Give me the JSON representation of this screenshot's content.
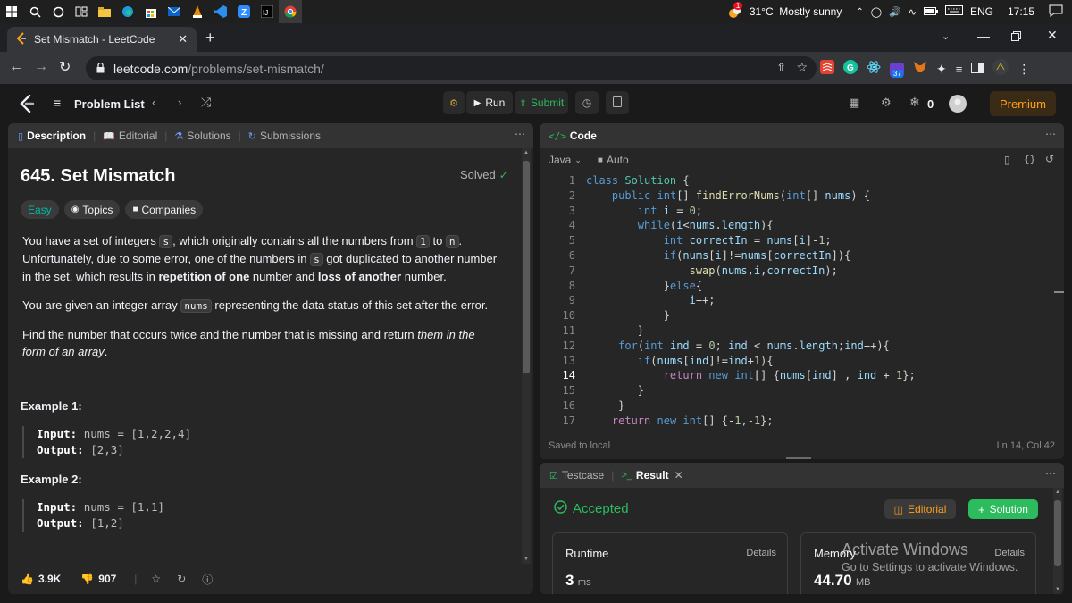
{
  "taskbar": {
    "weather": "31°C  Mostly sunny",
    "lang": "ENG",
    "time": "17:15",
    "weather_badge": "1"
  },
  "browser": {
    "tab_title": "Set Mismatch - LeetCode",
    "url_host": "leetcode.com",
    "url_path": "/problems/set-mismatch/",
    "ext_badge": "37"
  },
  "nav": {
    "problem_list": "Problem List",
    "run": "Run",
    "submit": "Submit",
    "streak": "0",
    "premium": "Premium"
  },
  "desc_tabs": [
    "Description",
    "Editorial",
    "Solutions",
    "Submissions"
  ],
  "problem": {
    "title": "645. Set Mismatch",
    "status": "Solved",
    "difficulty": "Easy",
    "topics": "Topics",
    "companies": "Companies",
    "p1": [
      "You have a set of integers ",
      "s",
      ", which originally contains all the numbers from ",
      "1",
      " to ",
      "n",
      ". Unfortunately, due to some error, one of the numbers in ",
      "s",
      " got duplicated to another number in the set, which results in ",
      "repetition of one",
      " number and ",
      "loss of another",
      " number."
    ],
    "p2": [
      "You are given an integer array ",
      "nums",
      " representing the data status of this set after the error."
    ],
    "p3": [
      "Find the number that occurs twice and the number that is missing and return ",
      "them in the form of an array",
      "."
    ],
    "ex1_title": "Example 1:",
    "ex1_input_label": "Input:",
    "ex1_input": "nums = [1,2,2,4]",
    "ex1_output_label": "Output:",
    "ex1_output": "[2,3]",
    "ex2_title": "Example 2:",
    "ex2_input_label": "Input:",
    "ex2_input": "nums = [1,1]",
    "ex2_output_label": "Output:",
    "ex2_output": "[1,2]",
    "likes": "3.9K",
    "dislikes": "907"
  },
  "code_panel": {
    "title": "Code",
    "language": "Java",
    "auto": "Auto",
    "saved": "Saved to local",
    "cursor": "Ln 14, Col 42",
    "current_line": 14,
    "lines": [
      "class Solution {",
      "    public int[] findErrorNums(int[] nums) {",
      "        int i = 0;",
      "        while(i<nums.length){",
      "            int correctIn = nums[i]-1;",
      "            if(nums[i]!=nums[correctIn]){",
      "                swap(nums,i,correctIn);",
      "            }else{",
      "                i++;",
      "            }",
      "        }",
      "     for(int ind = 0; ind < nums.length;ind++){",
      "        if(nums[ind]!=ind+1){",
      "            return new int[] {nums[ind] , ind + 1};",
      "        }",
      "     }",
      "    return new int[] {-1,-1};"
    ]
  },
  "result_panel": {
    "testcase": "Testcase",
    "result": "Result",
    "accepted": "Accepted",
    "editorial": "Editorial",
    "solution": "Solution",
    "runtime_label": "Runtime",
    "runtime_value": "3",
    "runtime_unit": "ms",
    "details": "Details",
    "memory_label": "Memory",
    "memory_value": "44.70",
    "memory_unit": "MB"
  },
  "watermark": {
    "line1": "Activate Windows",
    "line2": "Go to Settings to activate Windows."
  }
}
